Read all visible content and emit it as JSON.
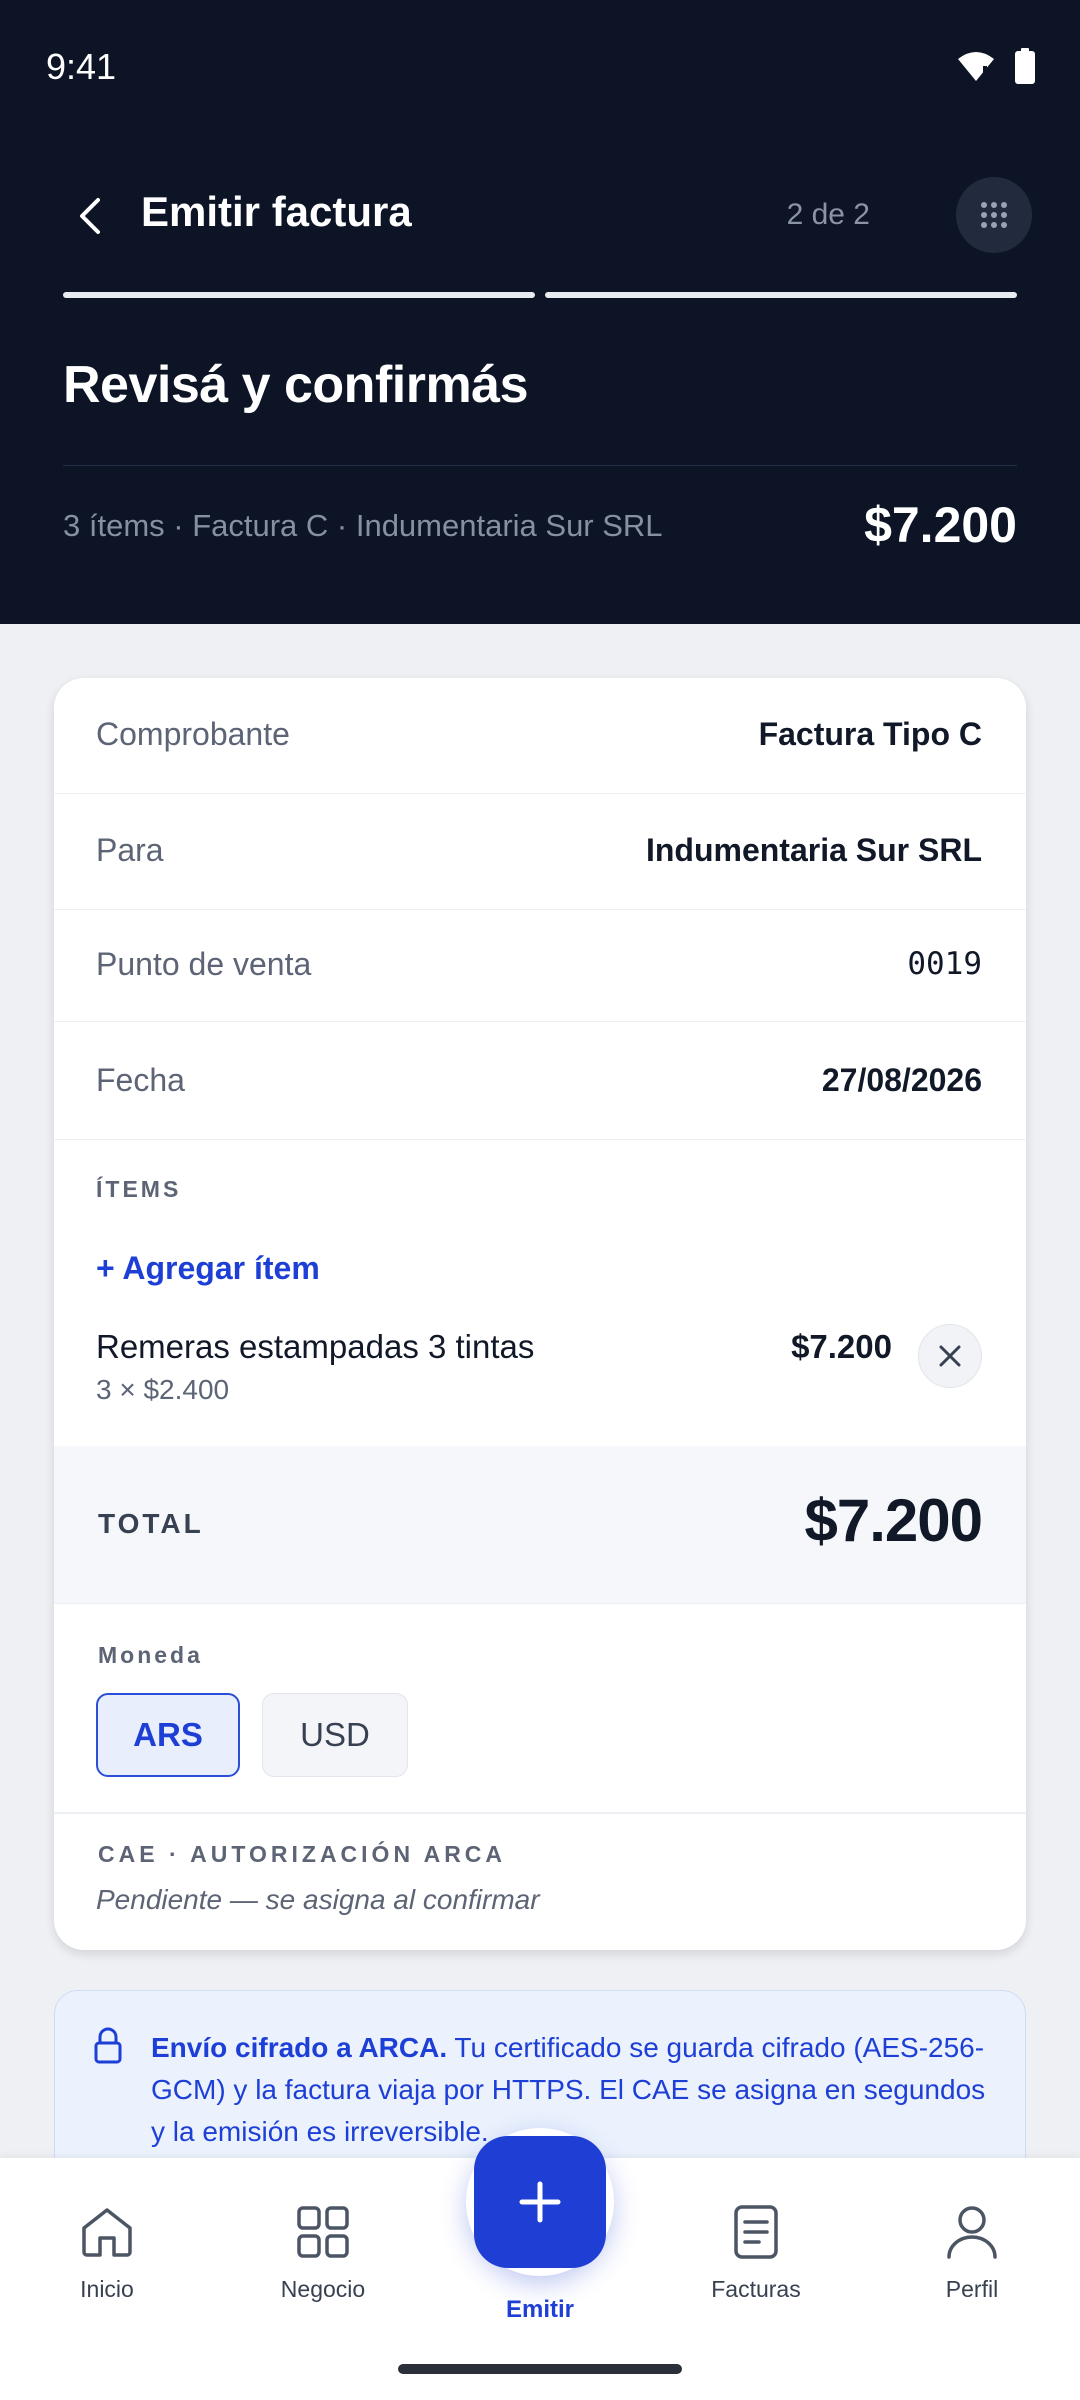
{
  "status_bar": {
    "time": "9:41"
  },
  "nav": {
    "title": "Emitir factura",
    "step": "2 de 2",
    "progress_current": 2,
    "progress_total": 2
  },
  "header": {
    "heading": "Revisá y confirmás",
    "summary": "3 ítems · Factura C · Indumentaria Sur SRL",
    "total": "$7.200"
  },
  "details": [
    {
      "label": "Comprobante",
      "value": "Factura Tipo C"
    },
    {
      "label": "Para",
      "value": "Indumentaria Sur SRL"
    },
    {
      "label": "Punto de venta",
      "value": "0019"
    },
    {
      "label": "Fecha",
      "value": "27/08/2026"
    }
  ],
  "items_section": {
    "heading": "ÍTEMS",
    "add_label": "+ Agregar ítem",
    "items": [
      {
        "name": "Remeras estampadas 3 tintas",
        "detail": "3 × $2.400",
        "amount": "$7.200"
      }
    ]
  },
  "total": {
    "label": "TOTAL",
    "value": "$7.200"
  },
  "currency": {
    "label": "Moneda",
    "options": [
      "ARS",
      "USD"
    ],
    "selected": "ARS"
  },
  "cae": {
    "label": "CAE · AUTORIZACIÓN ARCA",
    "status": "Pendiente — se asigna al confirmar"
  },
  "notice": {
    "bold": "Envío cifrado a ARCA.",
    "text": " Tu certificado se guarda cifrado (AES-256-GCM) y la factura viaja por HTTPS. El CAE se asigna en segundos y la emisión es irreversible."
  },
  "bottom_nav": {
    "items": [
      {
        "label": "Inicio",
        "icon": "home-icon"
      },
      {
        "label": "Negocio",
        "icon": "grid-icon"
      },
      {
        "label": "Emitir",
        "icon": "plus-icon"
      },
      {
        "label": "Facturas",
        "icon": "document-icon"
      },
      {
        "label": "Perfil",
        "icon": "user-icon"
      }
    ]
  },
  "colors": {
    "header_bg": "#0c1426",
    "accent": "#1f3fd4",
    "page_bg": "#eef0f4"
  }
}
